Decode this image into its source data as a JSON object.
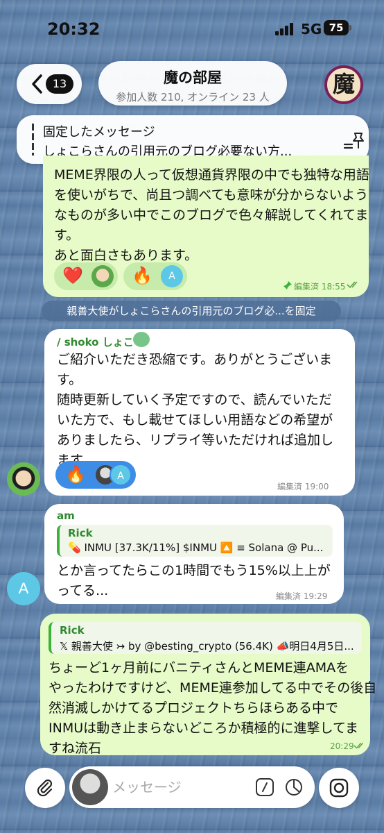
{
  "status_bar": {
    "time": "20:32",
    "network": "5G",
    "battery": "75"
  },
  "header": {
    "unread_count": "13",
    "title": "魔の部屋",
    "subtitle": "参加人数 210, オンライン 23 人",
    "avatar_char": "魔"
  },
  "pinned": {
    "label": "固定したメッセージ",
    "text": "しょこらさんの引用元のブログ必要ない方..."
  },
  "messages": [
    {
      "lines": [
        "MEME界限の人って仮想通貨界限の中でも独特な用語",
        "を使いがちで、尚且つ調べても意味が分からないよう",
        "なものが多い中でこのブログで色々解説してくれてま",
        "す。",
        "あと面白さもあります。"
      ],
      "reactions": [
        "❤️",
        "🔥"
      ],
      "meta": "編集済 18:55"
    },
    {
      "system": "親善大使がしょこらさんの引用元のブログ必...を固定"
    },
    {
      "sender": "/ shoko しょこ",
      "lines": [
        "ご紹介いただき恐縮です。ありがとうございま",
        "す。",
        "随時更新していく予定ですので、読んでいただ",
        "いた方で、もし載せてほしい用語などの希望が",
        "ありましたら、リプライ等いただければ追加し",
        "ます。"
      ],
      "reactions": [
        "🔥"
      ],
      "meta": "編集済 19:00"
    },
    {
      "sender": "am",
      "quote_name": "Rick",
      "quote_text": "💊 INMU [37.3K/11%] $INMU 🔼 ≡ Solana @ Pu...",
      "lines": [
        "とか言ってたらこの1時間でもう15%以上上が",
        "ってる..."
      ],
      "meta": "編集済 19:29",
      "avatar_letter": "A"
    },
    {
      "quote_name": "Rick",
      "quote_text": "𝕏 親善大使 ↣ by @besting_crypto (56.4K) 📣明日4月5日...",
      "lines": [
        "ちょーど1ヶ月前にバニティさんとMEME連AMAを",
        "やったわけですけど、MEME連参加してる中でその後自",
        "然消滅しかけてるプロジェクトちらほらある中で",
        "INMUは動き止まらないどころか積極的に進撃してま",
        "すね流石"
      ],
      "meta": "20:29"
    }
  ],
  "input": {
    "placeholder": "メッセージ"
  },
  "colors": {
    "outgoing_bubble": "#e6fbc8",
    "incoming_bubble": "#ffffff",
    "accent_green": "#2f8a2f",
    "reaction_blue": "#3d8de6",
    "avatar_a": "#5cc8e6"
  },
  "icons": {
    "back": "chevron-left-icon",
    "pinned_list": "pin-list-icon",
    "attach": "paperclip-icon",
    "command": "slash-command-icon",
    "timer": "timer-icon",
    "camera": "camera-icon"
  }
}
